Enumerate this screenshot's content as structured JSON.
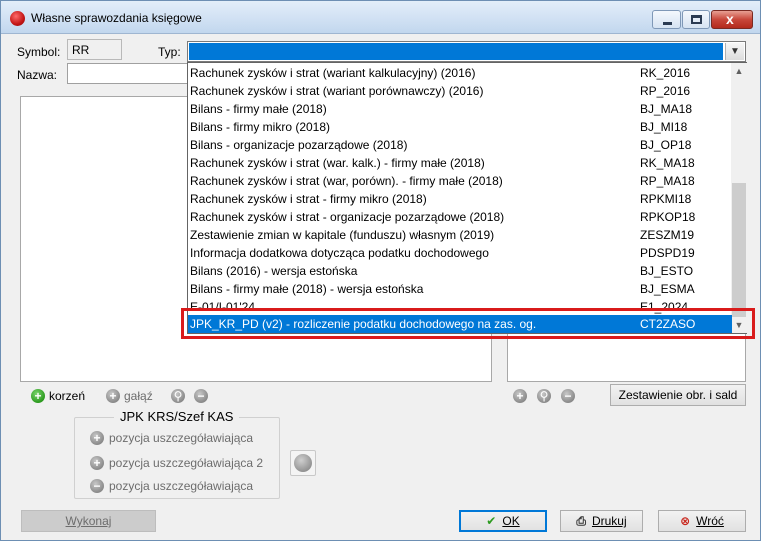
{
  "window": {
    "title": "Własne sprawozdania księgowe",
    "close_glyph": "x"
  },
  "form": {
    "symbol_label": "Symbol:",
    "symbol_value": "RR",
    "typ_label": "Typ:",
    "nazwa_label": "Nazwa:"
  },
  "dropdown_items": [
    {
      "name": "Rachunek zysków i strat (wariant kalkulacyjny) (2016)",
      "code": "RK_2016"
    },
    {
      "name": "Rachunek zysków i strat (wariant porównawczy) (2016)",
      "code": "RP_2016"
    },
    {
      "name": "Bilans - firmy małe (2018)",
      "code": "BJ_MA18"
    },
    {
      "name": "Bilans - firmy mikro (2018)",
      "code": "BJ_MI18"
    },
    {
      "name": "Bilans - organizacje pozarządowe (2018)",
      "code": "BJ_OP18"
    },
    {
      "name": "Rachunek zysków i strat (war. kalk.) - firmy małe (2018)",
      "code": "RK_MA18"
    },
    {
      "name": "Rachunek zysków i strat (war, porówn). - firmy małe (2018)",
      "code": "RP_MA18"
    },
    {
      "name": "Rachunek zysków i strat - firmy mikro (2018)",
      "code": "RPKMI18"
    },
    {
      "name": "Rachunek zysków i strat - organizacje pozarządowe (2018)",
      "code": "RPKOP18"
    },
    {
      "name": "Zestawienie zmian w kapitale (funduszu) własnym (2019)",
      "code": "ZESZM19"
    },
    {
      "name": "Informacja dodatkowa dotycząca podatku dochodowego",
      "code": "PDSPD19"
    },
    {
      "name": "Bilans (2016) - wersja estońska",
      "code": "BJ_ESTO"
    },
    {
      "name": "Bilans - firmy małe (2018) - wersja estońska",
      "code": "BJ_ESMA"
    },
    {
      "name": "E-01/I-01'24",
      "code": "E1_2024"
    },
    {
      "name": "JPK_KR_PD (v2) - rozliczenie podatku dochodowego na zas. og.",
      "code": "CT2ZASO",
      "selected": true
    }
  ],
  "toolbar_left": {
    "root_label": "korzeń",
    "branch_label": "gałąź"
  },
  "toolbar_right": {
    "summary_button": "Zestawienie obr. i sald"
  },
  "group": {
    "title": "JPK KRS/Szef KAS",
    "items": [
      "pozycja uszczegóławiająca",
      "pozycja uszczegóławiająca 2",
      "pozycja uszczegóławiająca"
    ]
  },
  "buttons": {
    "execute": "Wykonaj",
    "ok": "OK",
    "print": "Drukuj",
    "back": "Wróć"
  },
  "colors": {
    "selection": "#0078d7",
    "highlight_frame": "#d91b1b"
  }
}
